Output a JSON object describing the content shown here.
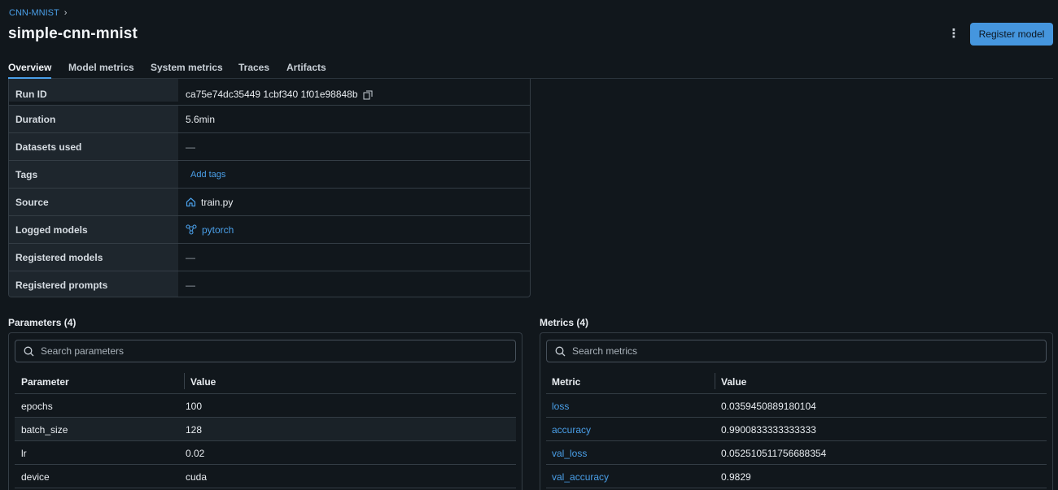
{
  "breadcrumb": {
    "experiment": "CNN-MNIST",
    "chevron": "›"
  },
  "run": {
    "name": "simple-cnn-mnist"
  },
  "header": {
    "more_icon": "⋮",
    "register_label": "Register model"
  },
  "tabs": [
    "Overview",
    "Model metrics",
    "System metrics",
    "Traces",
    "Artifacts"
  ],
  "active_tab": "Overview",
  "details": {
    "run_id_label": "Run ID",
    "run_id": "ca75e74dc35449 1cbf340 1f01e98848b",
    "duration_label": "Duration",
    "duration": "5.6min",
    "datasets_label": "Datasets used",
    "datasets": "—",
    "tags_label": "Tags",
    "add_tags": "Add tags",
    "source_label": "Source",
    "source": "train.py",
    "logged_models_label": "Logged models",
    "logged_model": "pytorch",
    "registered_models_label": "Registered models",
    "registered_models": "—",
    "registered_prompts_label": "Registered prompts",
    "registered_prompts": "—"
  },
  "parameters": {
    "title": "Parameters (4)",
    "search_placeholder": "Search parameters",
    "col_name": "Parameter",
    "col_value": "Value",
    "rows": [
      {
        "name": "epochs",
        "value": "100"
      },
      {
        "name": "batch_size",
        "value": "128"
      },
      {
        "name": "lr",
        "value": "0.02"
      },
      {
        "name": "device",
        "value": "cuda"
      }
    ]
  },
  "metrics": {
    "title": "Metrics (4)",
    "search_placeholder": "Search metrics",
    "col_name": "Metric",
    "col_value": "Value",
    "rows": [
      {
        "name": "loss",
        "value": "0.0359450889180104"
      },
      {
        "name": "accuracy",
        "value": "0.9900833333333333"
      },
      {
        "name": "val_loss",
        "value": "0.052510511756688354"
      },
      {
        "name": "val_accuracy",
        "value": "0.9829"
      }
    ]
  },
  "icons": {
    "copy": "copy-icon",
    "source": "home-icon",
    "model": "model-icon",
    "search": "search-icon",
    "more": "more-vertical-icon"
  },
  "colors": {
    "accent": "#4a9fe8",
    "button": "#4596de",
    "background": "#11171c",
    "key_cell": "#1e262d"
  }
}
